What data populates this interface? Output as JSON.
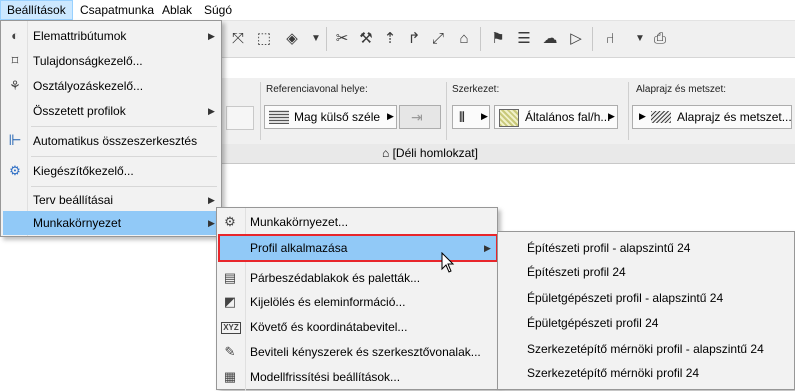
{
  "menubar": {
    "items": [
      {
        "label": "Beállítások",
        "active": true
      },
      {
        "label": "Csapatmunka"
      },
      {
        "label": "Ablak"
      },
      {
        "label": "Súgó"
      }
    ]
  },
  "infobox": {
    "ref_label": "Referenciavonal helye:",
    "ref_value": "Mag külső széle",
    "structure_label": "Szerkezet:",
    "structure_value": "Általános fal/h...",
    "floorplan_label": "Alaprajz és metszet:",
    "floorplan_value": "Alaprajz és metszet..."
  },
  "tab": {
    "label": "[Déli homlokzat]"
  },
  "settings_menu": {
    "items": [
      {
        "label": "Elemattribútumok",
        "icon": "palette-icon",
        "submenu": true
      },
      {
        "label": "Tulajdonságkezelő...",
        "icon": "tag-icon"
      },
      {
        "label": "Osztályozáskezelő...",
        "icon": "hierarchy-icon"
      },
      {
        "label": "Összetett profilok",
        "submenu": true
      },
      {
        "label": "Automatikus összeszerkesztés",
        "icon": "merge-icon"
      },
      {
        "label": "Kiegészítőkezelő...",
        "icon": "gear-icon"
      },
      {
        "label": "Terv beállításai",
        "submenu": true
      },
      {
        "label": "Munkakörnyezet",
        "submenu": true,
        "highlighted": true
      }
    ]
  },
  "workenv_menu": {
    "items": [
      {
        "label": "Munkakörnyezet...",
        "icon": "workenv-icon"
      },
      {
        "label": "Profil alkalmazása",
        "submenu": true,
        "highlighted": true
      },
      {
        "label": "Párbeszédablakok és paletták...",
        "icon": "dialog-icon"
      },
      {
        "label": "Kijelölés és eleminformáció...",
        "icon": "selection-icon"
      },
      {
        "label": "Követő és koordinátabevitel...",
        "icon": "xyz-icon"
      },
      {
        "label": "Beviteli kényszerek és szerkesztővonalak...",
        "icon": "pen-icon"
      },
      {
        "label": "Modellfrissítési beállítások...",
        "icon": "bricks-icon"
      }
    ]
  },
  "profile_menu": {
    "items": [
      {
        "label": "Építészeti profil - alapszintű 24"
      },
      {
        "label": "Építészeti profil 24"
      },
      {
        "label": "Épületgépészeti profil - alapszintű 24"
      },
      {
        "label": "Épületgépészeti profil 24"
      },
      {
        "label": "Szerkezetépítő mérnöki profil - alapszintű 24"
      },
      {
        "label": "Szerkezetépítő mérnöki profil 24"
      }
    ]
  },
  "colors": {
    "highlight": "#91c9f7",
    "focus_border": "#e8262b",
    "menu_bg": "#f2f2f2"
  }
}
